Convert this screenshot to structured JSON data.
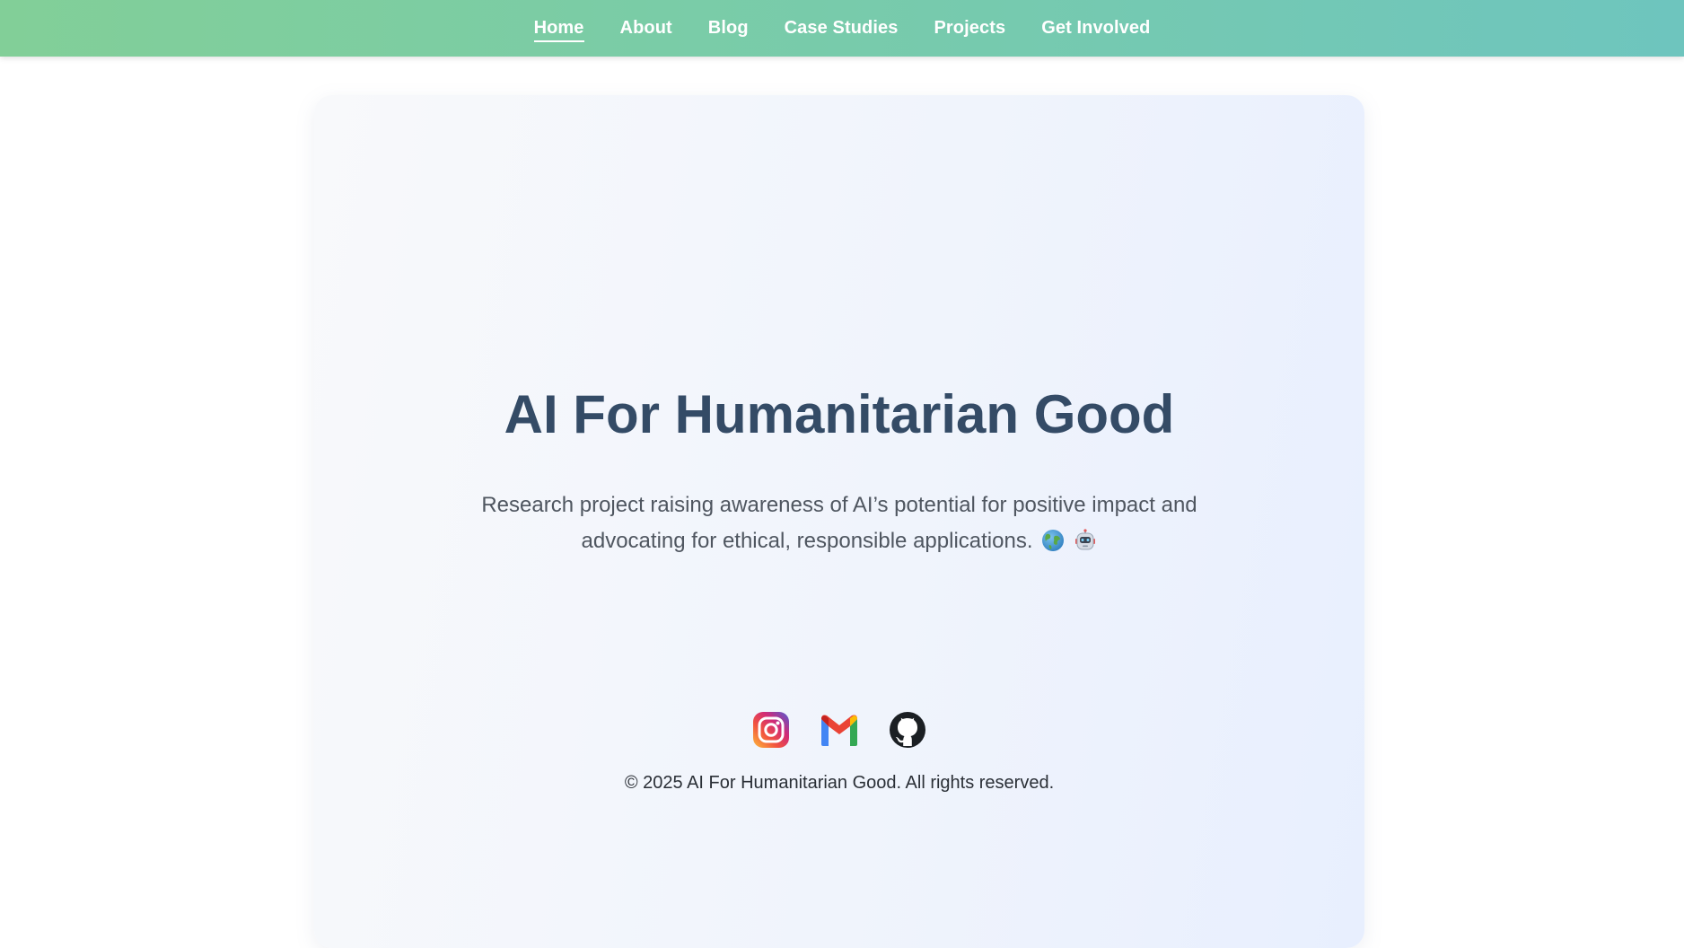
{
  "nav": {
    "items": [
      {
        "label": "Home",
        "active": true
      },
      {
        "label": "About"
      },
      {
        "label": "Blog"
      },
      {
        "label": "Case Studies"
      },
      {
        "label": "Projects"
      },
      {
        "label": "Get Involved"
      }
    ]
  },
  "hero": {
    "title": "AI For Humanitarian Good",
    "description": "Research project raising awareness of AI’s potential for positive impact and advocating for ethical, responsible applications.",
    "emojis": [
      "globe-icon",
      "robot-icon"
    ]
  },
  "socials": [
    "instagram-icon",
    "gmail-icon",
    "github-icon"
  ],
  "footer": {
    "copyright": "© 2025 AI For Humanitarian Good. All rights reserved."
  },
  "colors": {
    "nav_gradient_start": "#82cf98",
    "nav_gradient_end": "#6ec5be",
    "title": "#344b66",
    "text": "#4f5660"
  }
}
